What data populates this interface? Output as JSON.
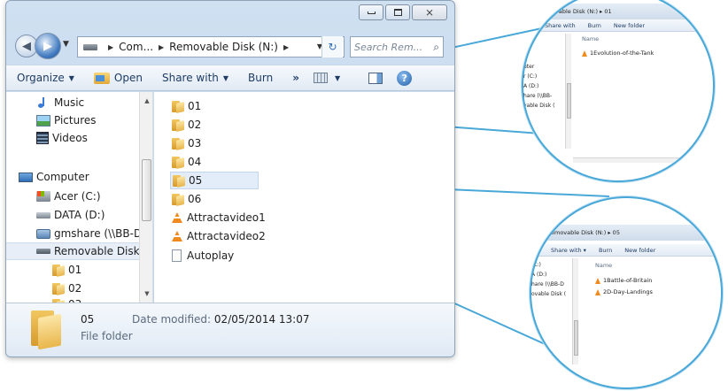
{
  "window": {
    "close_glyph": "⨯",
    "address": {
      "crumbs": [
        "Com...",
        "Removable Disk (N:)"
      ]
    },
    "search_placeholder": "Search Rem...",
    "toolbar": {
      "organize": "Organize",
      "open": "Open",
      "share_with": "Share with",
      "burn": "Burn",
      "more": "»"
    },
    "nav_pane": {
      "items": [
        {
          "label": "Music",
          "icon": "music-icon"
        },
        {
          "label": "Pictures",
          "icon": "pictures-icon"
        },
        {
          "label": "Videos",
          "icon": "videos-icon"
        },
        {
          "label": "Computer",
          "icon": "computer-icon"
        },
        {
          "label": "Acer (C:)",
          "icon": "system-drive-icon"
        },
        {
          "label": "DATA (D:)",
          "icon": "drive-icon"
        },
        {
          "label": "gmshare (\\\\BB-D",
          "icon": "network-drive-icon"
        },
        {
          "label": "Removable Disk (",
          "icon": "removable-disk-icon"
        },
        {
          "label": "01",
          "icon": "folder-icon"
        },
        {
          "label": "02",
          "icon": "folder-icon"
        },
        {
          "label": "03",
          "icon": "folder-icon"
        }
      ]
    },
    "files": [
      {
        "name": "01",
        "kind": "folder"
      },
      {
        "name": "02",
        "kind": "folder"
      },
      {
        "name": "03",
        "kind": "folder"
      },
      {
        "name": "04",
        "kind": "folder"
      },
      {
        "name": "05",
        "kind": "folder"
      },
      {
        "name": "06",
        "kind": "folder"
      },
      {
        "name": "Attractavideo1",
        "kind": "vlc"
      },
      {
        "name": "Attractavideo2",
        "kind": "vlc"
      },
      {
        "name": "Autoplay",
        "kind": "file"
      }
    ],
    "selected_file": "05",
    "details": {
      "name": "05",
      "type": "File folder",
      "modified_label": "Date modified:",
      "modified_value": "02/05/2014 13:07"
    }
  },
  "zoom_top": {
    "address": "vable Disk (N:) ▸ 01",
    "toolbar": [
      "Share with",
      "Burn",
      "New folder"
    ],
    "name_header": "Name",
    "nav_items": [
      "s",
      "",
      "uter",
      "r (C:)",
      "A (D:)",
      "hare (\\\\BB-",
      "vable Disk ("
    ],
    "files": [
      "1Evolution-of-the-Tank"
    ]
  },
  "zoom_bottom": {
    "address": "emovable Disk (N:) ▸ 05",
    "toolbar": [
      "Share with ▾",
      "Burn",
      "New folder"
    ],
    "name_header": "Name",
    "nav_items": [
      "(C:)",
      "A (D:)",
      "hare (\\\\BB-D",
      "ovable Disk ("
    ],
    "files": [
      "1Battle-of-Britain",
      "2D-Day-Landings"
    ]
  },
  "colors": {
    "connector": "#49a8d8",
    "selection": "#e3edf9"
  }
}
